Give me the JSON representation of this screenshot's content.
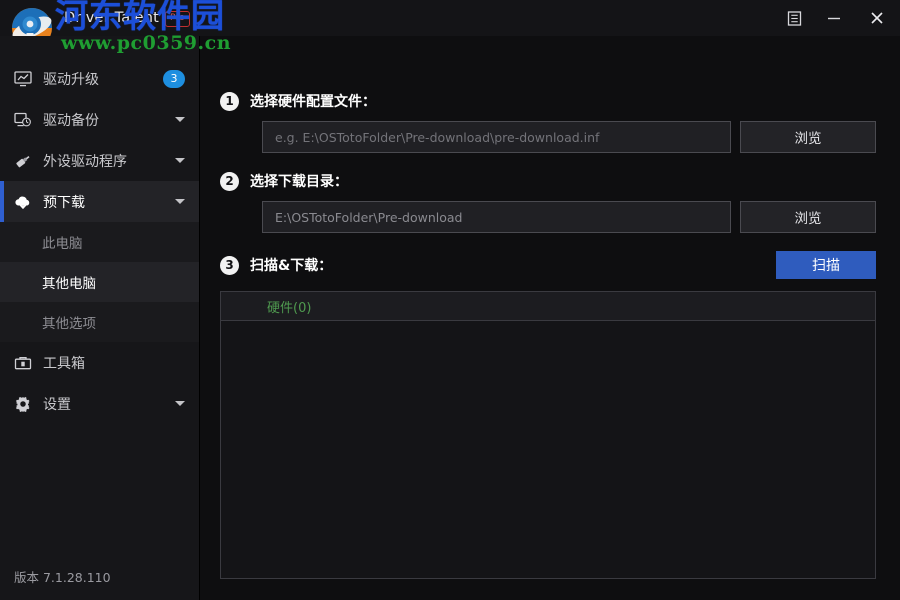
{
  "window": {
    "title": "Driver Talent",
    "pro_badge": "Pro",
    "menu_icon": "menu-icon",
    "minimize_icon": "minimize-icon",
    "close_icon": "close-icon"
  },
  "watermark": {
    "site_name": "河东软件园",
    "site_url": "www.pc0359.cn",
    "site_name_color": "#1c4fd8",
    "site_url_color": "#1f9e32"
  },
  "sidebar": {
    "items": [
      {
        "label": "驱动升级",
        "icon": "monitor-upgrade-icon",
        "badge": "3",
        "caret": false,
        "active": false
      },
      {
        "label": "驱动备份",
        "icon": "monitor-clock-icon",
        "badge": null,
        "caret": true,
        "active": false
      },
      {
        "label": "外设驱动程序",
        "icon": "usb-plug-icon",
        "badge": null,
        "caret": true,
        "active": false
      },
      {
        "label": "预下载",
        "icon": "cloud-download-icon",
        "badge": null,
        "caret": true,
        "active": true
      }
    ],
    "subitems": [
      {
        "label": "此电脑",
        "selected": false
      },
      {
        "label": "其他电脑",
        "selected": true
      },
      {
        "label": "其他选项",
        "selected": false
      }
    ],
    "items_after": [
      {
        "label": "工具箱",
        "icon": "toolbox-icon",
        "badge": null,
        "caret": false,
        "active": false
      },
      {
        "label": "设置",
        "icon": "gear-icon",
        "badge": null,
        "caret": true,
        "active": false
      }
    ],
    "version": "版本 7.1.28.110",
    "active_accent": "#2f5fd0",
    "badge_color": "#1e8fe0"
  },
  "main": {
    "step1": {
      "number": "1",
      "label": "选择硬件配置文件：",
      "input_placeholder": "e.g. E:\\OSTotoFolder\\Pre-download\\pre-download.inf",
      "input_value": "",
      "browse_label": "浏览"
    },
    "step2": {
      "number": "2",
      "label": "选择下载目录：",
      "input_placeholder": "E:\\OSTotoFolder\\Pre-download",
      "input_value": "E:\\OSTotoFolder\\Pre-download",
      "browse_label": "浏览"
    },
    "step3": {
      "number": "3",
      "label": "扫描&下载：",
      "scan_label": "扫描",
      "scan_color": "#2f5cbe"
    },
    "results": {
      "column_header": "硬件(0)",
      "header_color": "#4f9a4f",
      "rows": []
    }
  }
}
